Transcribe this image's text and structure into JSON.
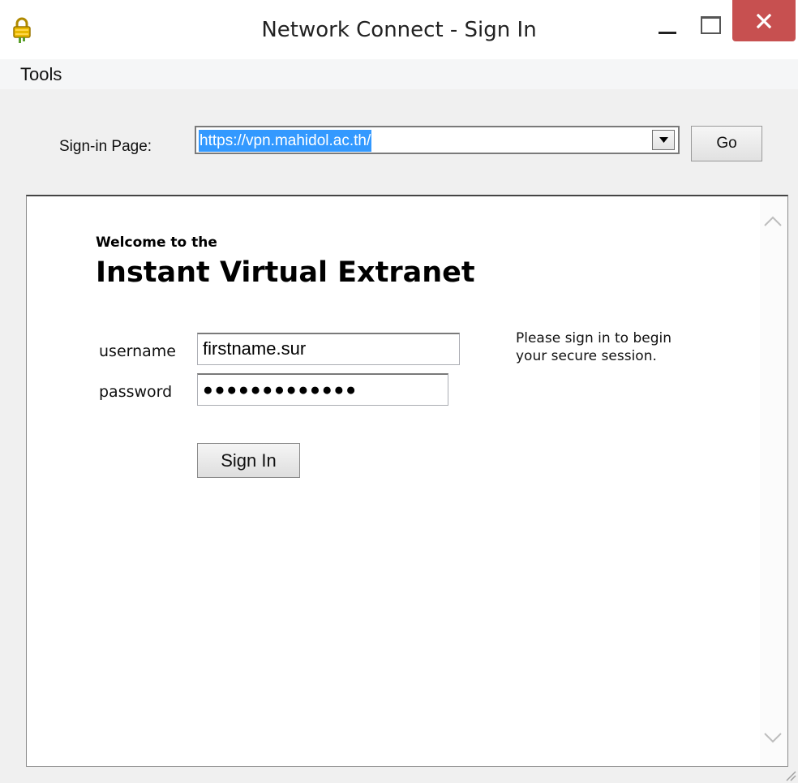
{
  "window": {
    "title": "Network Connect - Sign In",
    "icon": "padlock-icon"
  },
  "menu": {
    "items": [
      "Tools"
    ]
  },
  "signin_bar": {
    "label": "Sign-in Page:",
    "url_value": "https://vpn.mahidol.ac.th/",
    "go_label": "Go"
  },
  "form": {
    "welcome_small": "Welcome to the",
    "welcome_big": "Instant Virtual Extranet",
    "username_label": "username",
    "username_value": "firstname.sur",
    "password_label": "password",
    "password_value": "●●●●●●●●●●●●●",
    "info_text": "Please sign in to begin your secure session.",
    "signin_label": "Sign In"
  },
  "colors": {
    "close_button": "#c75050",
    "selection": "#3399ff",
    "icon_gold": "#e8b800"
  }
}
